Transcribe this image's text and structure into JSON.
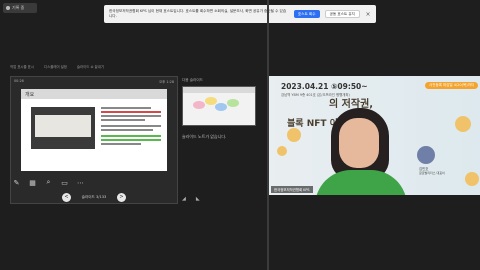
{
  "record": {
    "label": "기록 중"
  },
  "banner": {
    "message": "한국정보저작권협회 KPS 님이 현재 호스트입니다. 호스트를 회수하면 소회의실, 설문조사, 화면 공유가 중단될 수 있습니다.",
    "primary_label": "호스트 회수",
    "secondary_label": "공동 호스트 유지",
    "close_label": "×"
  },
  "ppt": {
    "toolbar": [
      "작업 표시줄 표시",
      "디스플레이 설정",
      "슬라이드 쇼 끝내기"
    ],
    "time": "00:26",
    "clock": "오후 1:28",
    "slide_title": "개요",
    "nav_label": "슬라이드 3/133",
    "prev_label": "<",
    "next_label": ">"
  },
  "next_panel": {
    "label": "다음 슬라이드",
    "notes": "슬라이드 노트가 없습니다."
  },
  "video": {
    "date": "2023.04.21 ⑤09:50~",
    "subtitle": "강남역 YBM 9층 401호 (온/오프라인 병행개최)",
    "pill": "사전등록 마감일 4/20(목)까지",
    "headline1": "의 저작권,",
    "headline2": "블록       NFT 이야기",
    "speaker_name": "김민호",
    "speaker_org": "글로벌리더스 대표이",
    "name_tag": "한국정보저작권협회 KPS"
  }
}
